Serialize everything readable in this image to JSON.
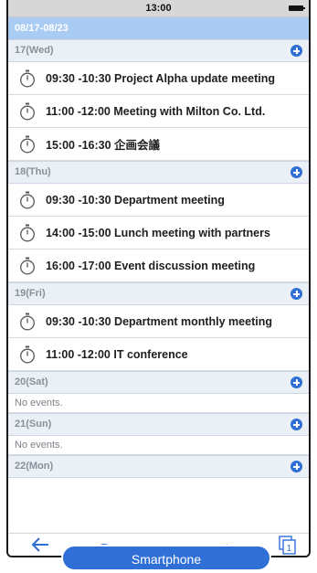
{
  "status": {
    "time": "13:00"
  },
  "range": "08/17-08/23",
  "days": [
    {
      "header": "17(Wed)",
      "events": [
        "09:30 -10:30 Project Alpha update meeting",
        "11:00 -12:00 Meeting with Milton Co. Ltd.",
        "15:00 -16:30 企画会議"
      ]
    },
    {
      "header": "18(Thu)",
      "events": [
        "09:30 -10:30 Department meeting",
        "14:00 -15:00 Lunch meeting with partners",
        "16:00 -17:00 Event discussion meeting"
      ]
    },
    {
      "header": "19(Fri)",
      "events": [
        "09:30 -10:30 Department monthly meeting",
        "11:00 -12:00 IT conference"
      ]
    },
    {
      "header": "20(Sat)",
      "empty": "No events."
    },
    {
      "header": "21(Sun)",
      "empty": "No events."
    },
    {
      "header": "22(Mon)"
    }
  ],
  "toolbar": {
    "icons": [
      "back-arrow-icon",
      "circle-icon",
      "minus-icon",
      "share-icon",
      "copy-pages-icon"
    ],
    "pages_count": "1"
  },
  "label": "Smartphone",
  "colors": {
    "accent": "#2f6fd6",
    "range_bar": "#a9cbf4",
    "day_header": "#ebf0f7"
  }
}
